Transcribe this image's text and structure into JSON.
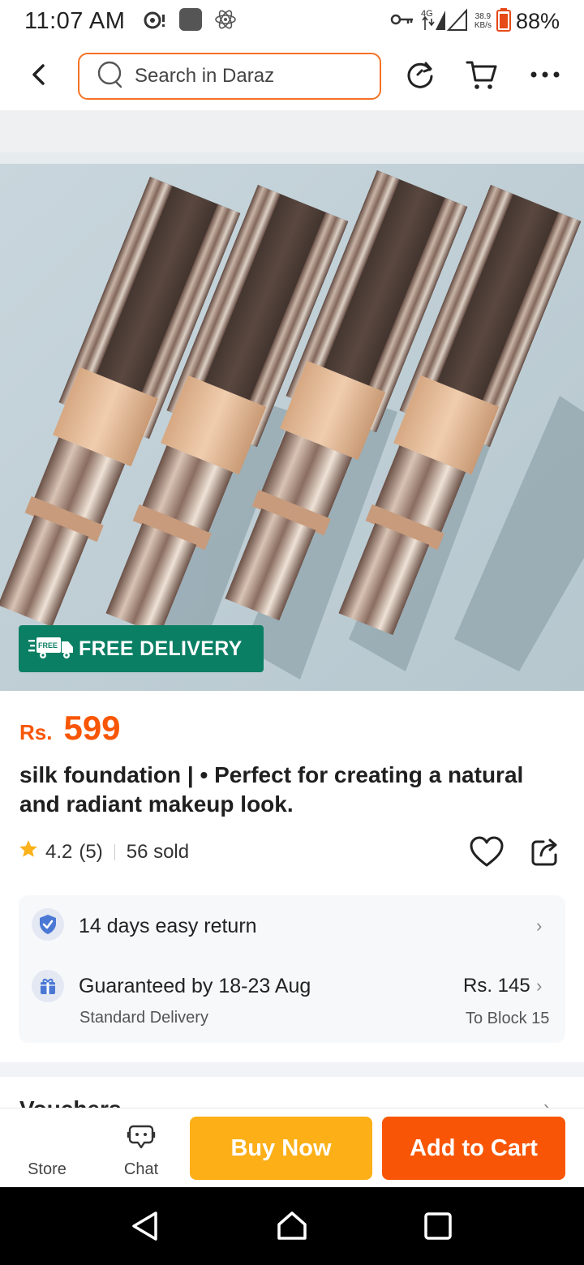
{
  "status_bar": {
    "time": "11:07 AM",
    "network": "4G",
    "speed_value": "38.9",
    "speed_unit": "KB/s",
    "battery": "88%",
    "icons": [
      "media-icon",
      "app-icon",
      "atom-icon",
      "vpn-key-icon",
      "signal-icon",
      "battery-icon"
    ]
  },
  "header": {
    "search_placeholder": "Search in Daraz",
    "icons": [
      "back-arrow-icon",
      "search-icon",
      "refresh-icon",
      "cart-icon",
      "more-icon"
    ]
  },
  "gallery": {
    "badge_text": "FREE DELIVERY",
    "badge_icon_text": "FREE",
    "badge_color": "#0a7f64"
  },
  "product": {
    "currency": "Rs.",
    "price": "599",
    "title": "silk foundation | • Perfect for creating a natural and radiant makeup look.",
    "rating": "4.2",
    "reviews": "(5)",
    "sold": "56 sold"
  },
  "services": {
    "return_text": "14 days easy return",
    "delivery_text": "Guaranteed by 18-23 Aug",
    "delivery_type": "Standard Delivery",
    "delivery_fee": "Rs. 145",
    "delivery_destination": "To Block 15"
  },
  "vouchers": {
    "title": "Vouchers"
  },
  "action_bar": {
    "store_label": "Store",
    "chat_label": "Chat",
    "buy_now_label": "Buy Now",
    "add_to_cart_label": "Add to Cart"
  },
  "colors": {
    "accent": "#f85606",
    "buy_now": "#fcaf17",
    "free_delivery": "#0a7f64"
  }
}
